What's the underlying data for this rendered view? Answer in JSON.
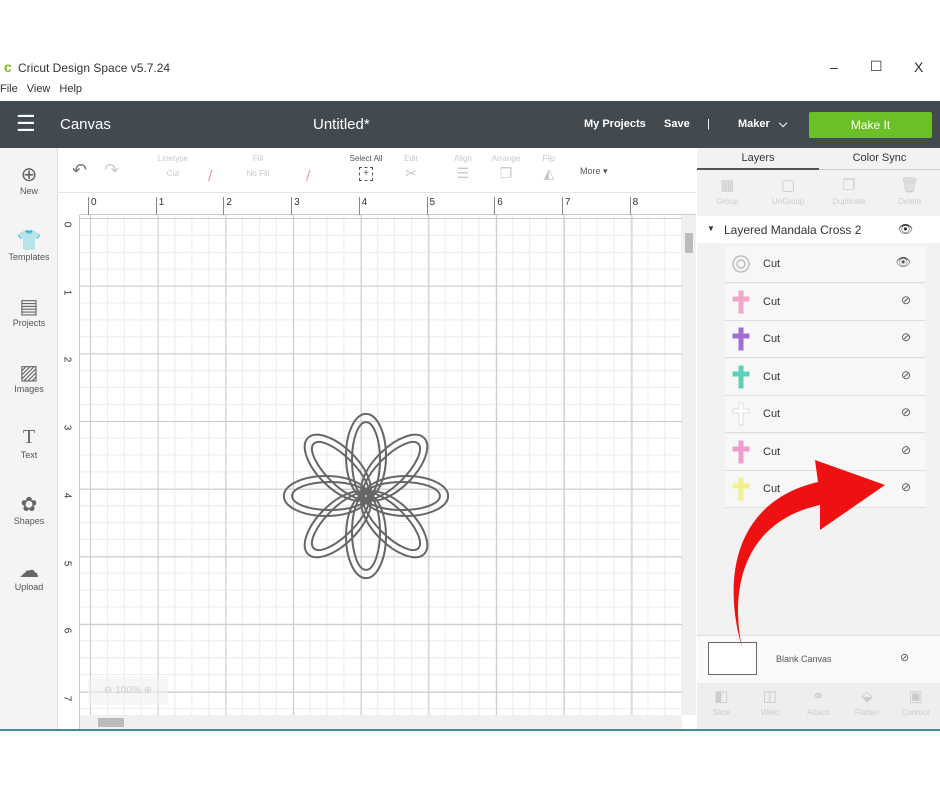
{
  "window": {
    "title": "Cricut Design Space  v5.7.24",
    "min": "–",
    "max": "☐",
    "close": "X"
  },
  "menu": [
    "File",
    "View",
    "Help"
  ],
  "header": {
    "section": "Canvas",
    "doc_title": "Untitled*",
    "my_projects": "My Projects",
    "save": "Save",
    "sep": "|",
    "machine": "Maker",
    "make_it": "Make It",
    "accent": "#6bbf27"
  },
  "sidebar": [
    {
      "label": "New",
      "icon": "plus-circle-icon"
    },
    {
      "label": "Templates",
      "icon": "shirt-icon"
    },
    {
      "label": "Projects",
      "icon": "projects-icon"
    },
    {
      "label": "Images",
      "icon": "image-icon"
    },
    {
      "label": "Text",
      "icon": "text-icon"
    },
    {
      "label": "Shapes",
      "icon": "shapes-icon"
    },
    {
      "label": "Upload",
      "icon": "upload-cloud-icon"
    }
  ],
  "toolbar": {
    "linetype_label": "Linetype",
    "linetype": "Cut",
    "fill_label": "Fill",
    "fill": "No Fill",
    "select_all": "Select All",
    "edit": "Edit",
    "align": "Align",
    "arrange": "Arrange",
    "flip": "Flip",
    "more": "More ▾"
  },
  "ruler_h": [
    "0",
    "1",
    "2",
    "3",
    "4",
    "5",
    "6",
    "7",
    "8"
  ],
  "ruler_v": [
    "0",
    "1",
    "2",
    "3",
    "4",
    "5",
    "6",
    "7"
  ],
  "zoom": "100%",
  "panel": {
    "tabs": [
      "Layers",
      "Color Sync"
    ],
    "actions": [
      "Group",
      "UnGroup",
      "Duplicate",
      "Delete"
    ],
    "group_name": "Layered Mandala Cross 2",
    "layers": [
      {
        "label": "Cut",
        "color": "#bdbdbd",
        "visible": true
      },
      {
        "label": "Cut",
        "color": "#f2a7c9",
        "visible": false
      },
      {
        "label": "Cut",
        "color": "#a070d0",
        "visible": false
      },
      {
        "label": "Cut",
        "color": "#5ecfb8",
        "visible": false
      },
      {
        "label": "Cut",
        "color": "#ffffff",
        "visible": false
      },
      {
        "label": "Cut",
        "color": "#f29bd0",
        "visible": false
      },
      {
        "label": "Cut",
        "color": "#f5ee8c",
        "visible": false
      }
    ],
    "blank_canvas": "Blank Canvas",
    "bottom_actions": [
      "Slice",
      "Weld",
      "Attach",
      "Flatten",
      "Contour"
    ]
  }
}
